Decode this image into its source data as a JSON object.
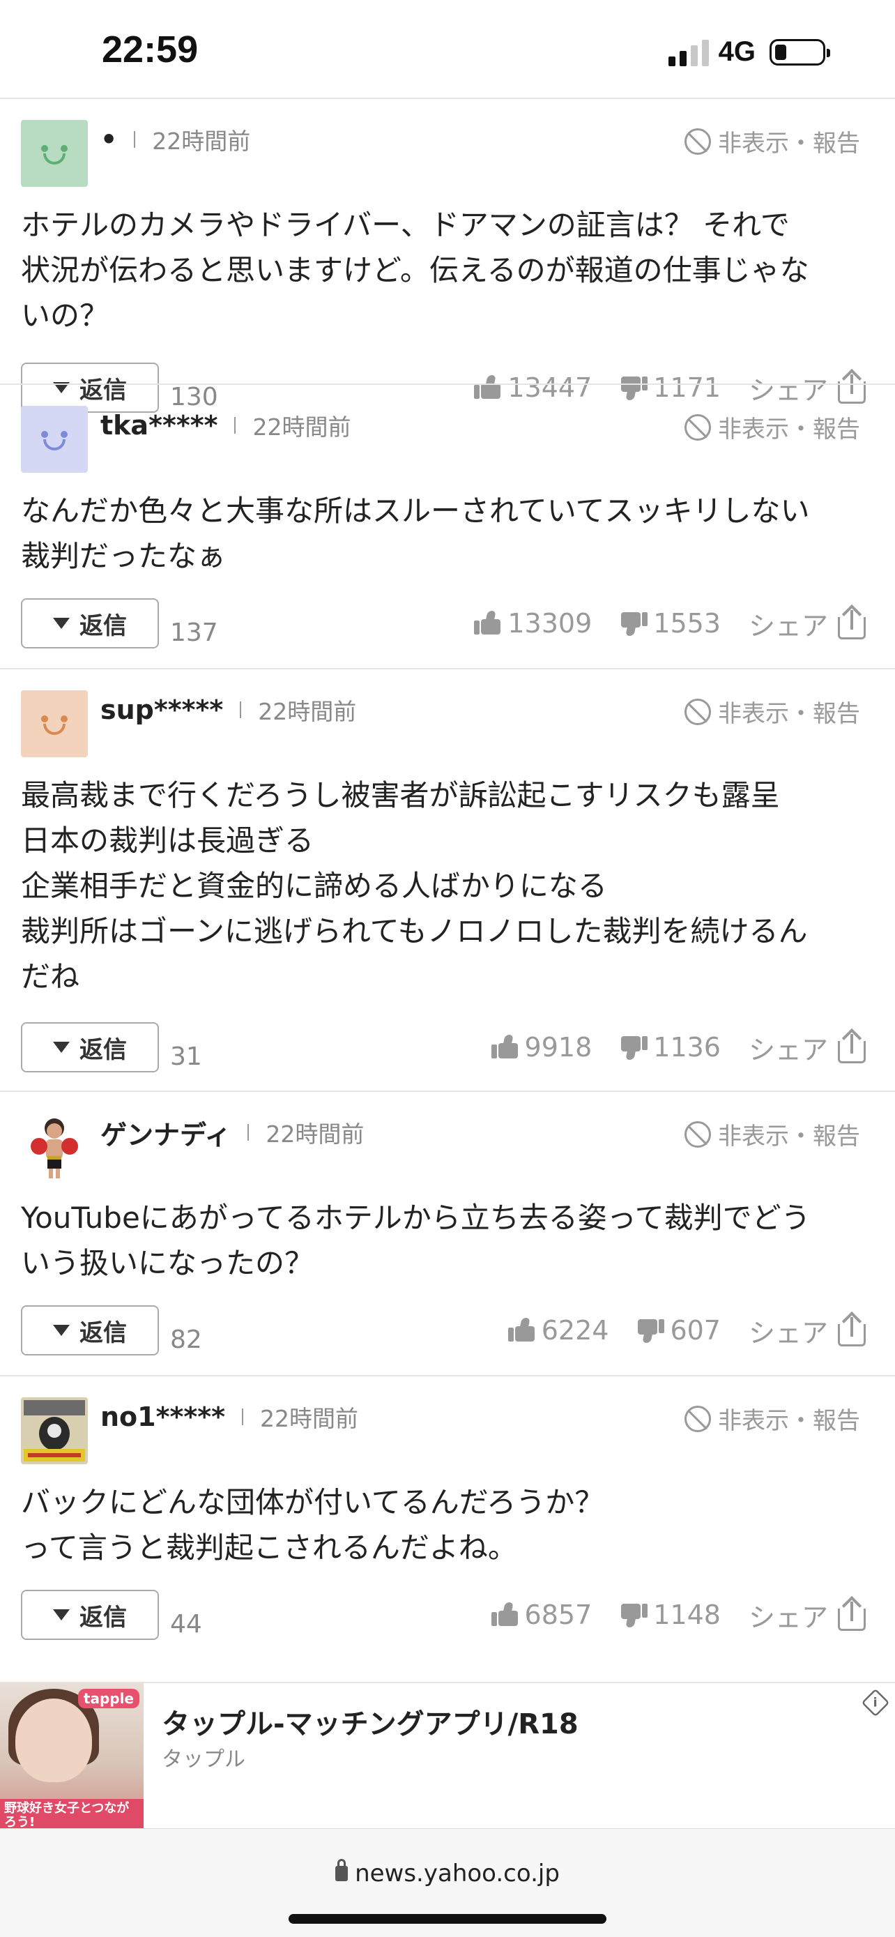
{
  "status_bar": {
    "time": "22:59",
    "network": "4G"
  },
  "colors": {
    "accent": "#999999",
    "avatar_green": "#b8dcc2",
    "avatar_blue": "#d4d8f4",
    "avatar_orange": "#f3d3bb"
  },
  "comment_ui": {
    "report_label": "非表示・報告",
    "reply_label": "返信",
    "share_label": "シェア"
  },
  "comments": [
    {
      "avatar": "smiley-green",
      "username": "•",
      "time": "22時間前",
      "text": "ホテルのカメラやドライバー、ドアマンの証言は？ それで\n状況が伝わると思いますけど。伝えるのが報道の仕事じゃな\nいの？",
      "reply_count": "130",
      "likes": "13447",
      "dislikes": "1171"
    },
    {
      "avatar": "smiley-blue",
      "username": "tka*****",
      "time": "22時間前",
      "text": "なんだか色々と大事な所はスルーされていてスッキリしない\n裁判だったなぁ",
      "reply_count": "137",
      "likes": "13309",
      "dislikes": "1553"
    },
    {
      "avatar": "smiley-orange",
      "username": "sup*****",
      "time": "22時間前",
      "text": "最高裁まで行くだろうし被害者が訴訟起こすリスクも露呈\n日本の裁判は長過ぎる\n企業相手だと資金的に諦める人ばかりになる\n裁判所はゴーンに逃げられてもノロノロした裁判を続けるん\nだね",
      "reply_count": "31",
      "likes": "9918",
      "dislikes": "1136"
    },
    {
      "avatar": "boxer-photo",
      "username": "ゲンナディ",
      "time": "22時間前",
      "text": "YouTubeにあがってるホテルから立ち去る姿って裁判でどう\nいう扱いになったの？",
      "reply_count": "82",
      "likes": "6224",
      "dislikes": "607"
    },
    {
      "avatar": "badge-photo",
      "username": "no1*****",
      "time": "22時間前",
      "text": "バックにどんな団体が付いてるんだろうか？\nって言うと裁判起こされるんだよね。",
      "reply_count": "44",
      "likes": "6857",
      "dislikes": "1148"
    }
  ],
  "ad": {
    "title": "タップル-マッチングアプリ/R18",
    "advertiser": "タップル",
    "thumb_brand": "tapple",
    "thumb_banner": "野球好き女子とつながろう!"
  },
  "browser": {
    "url": "news.yahoo.co.jp"
  }
}
